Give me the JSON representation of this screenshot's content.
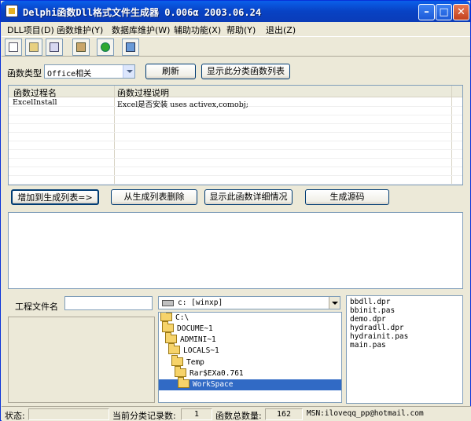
{
  "window": {
    "title": "Delphi函数Dll格式文件生成器   0.006α   2003.06.24"
  },
  "menu": [
    {
      "label": "DLL项目(D)"
    },
    {
      "label": "函数维护(Y)"
    },
    {
      "label": "数据库维护(W)"
    },
    {
      "label": "辅助功能(X)"
    },
    {
      "label": "帮助(Y)"
    },
    {
      "label": "退出(Z)"
    }
  ],
  "toolbar": {
    "icons": [
      "new-icon",
      "open-icon",
      "edit-icon",
      "paste-icon",
      "go-icon",
      "exit-icon"
    ]
  },
  "category": {
    "label": "函数类型",
    "selected": "Office相关",
    "refresh_label": "刷新",
    "show_list_label": "显示此分类函数列表"
  },
  "list": {
    "columns": [
      "函数过程名",
      "函数过程说明"
    ],
    "rows": [
      {
        "name": "ExcelInstall",
        "desc": "Excel是否安装     uses activex,comobj;"
      }
    ]
  },
  "actions": {
    "add": "增加到生成列表=>",
    "remove": "从生成列表删除",
    "details": "显示此函数详细情况",
    "generate": "生成源码"
  },
  "project": {
    "label": "工程文件名",
    "value": ""
  },
  "drive": {
    "selected": "c: [winxp]"
  },
  "directories": [
    {
      "name": "C:\\",
      "depth": 0,
      "selected": false
    },
    {
      "name": "DOCUME~1",
      "depth": 1,
      "selected": false
    },
    {
      "name": "ADMINI~1",
      "depth": 2,
      "selected": false
    },
    {
      "name": "LOCALS~1",
      "depth": 3,
      "selected": false
    },
    {
      "name": "Temp",
      "depth": 4,
      "selected": false
    },
    {
      "name": "Rar$EXa0.761",
      "depth": 5,
      "selected": false
    },
    {
      "name": "WorkSpace",
      "depth": 6,
      "selected": true
    }
  ],
  "files": [
    "bbdll.dpr",
    "bbinit.pas",
    "demo.dpr",
    "hydradll.dpr",
    "hydrainit.pas",
    "main.pas"
  ],
  "status": {
    "state_label": "状态:",
    "state_value": "",
    "count_label": "当前分类记录数:",
    "count_value": "1",
    "total_label": "函数总数量:",
    "total_value": "162",
    "msn": "MSN:iloveqq_pp@hotmail.com"
  }
}
